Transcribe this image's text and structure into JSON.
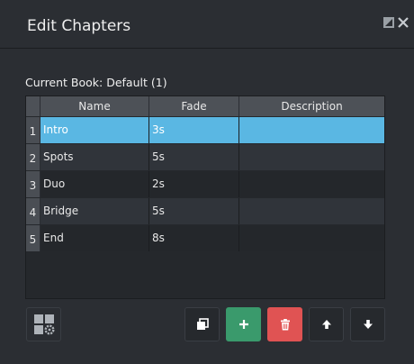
{
  "window": {
    "title": "Edit Chapters"
  },
  "book": {
    "label": "Current Book: Default (1)"
  },
  "table": {
    "columns": [
      "Name",
      "Fade",
      "Description"
    ],
    "rows": [
      {
        "num": "1",
        "name": "Intro",
        "fade": "3s",
        "description": ""
      },
      {
        "num": "2",
        "name": "Spots",
        "fade": "5s",
        "description": ""
      },
      {
        "num": "3",
        "name": "Duo",
        "fade": "2s",
        "description": ""
      },
      {
        "num": "4",
        "name": "Bridge",
        "fade": "5s",
        "description": ""
      },
      {
        "num": "5",
        "name": "End",
        "fade": "8s",
        "description": ""
      }
    ],
    "selected_row": 1
  },
  "toolbar": {
    "icons": [
      "layout-settings-icon",
      "copy-icon",
      "plus-icon",
      "trash-icon",
      "arrow-up-icon",
      "arrow-down-icon"
    ]
  },
  "colors": {
    "selection": "#5ab7e3",
    "add": "#3a9a6c",
    "delete": "#e05353"
  }
}
